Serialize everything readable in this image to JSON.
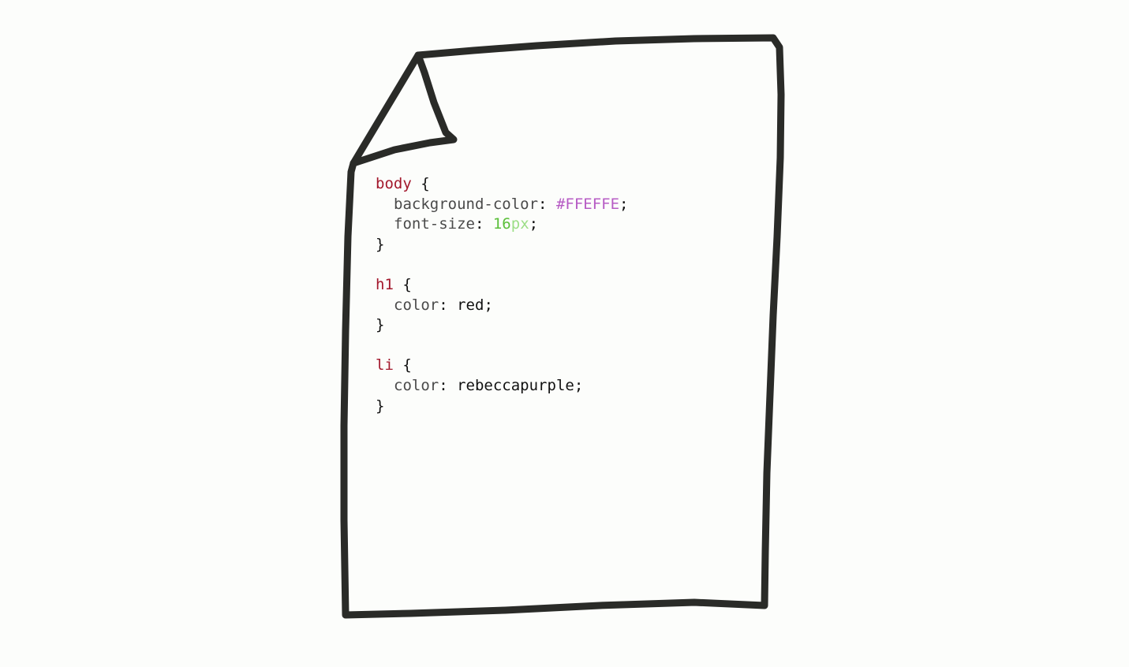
{
  "colors": {
    "background": "#FCFDFB",
    "page_fill": "#FCFDFB",
    "outline": "#2A2B28",
    "selector": "#A3182C",
    "property": "#4A4A4A",
    "hex_value": "#B65BC4",
    "number": "#5BBF3A",
    "unit": "#9CDE86"
  },
  "icons": {
    "document": "document-page-icon",
    "dog_ear": "folded-corner-icon"
  },
  "code": {
    "rules": [
      {
        "selector": "body",
        "open": "{",
        "close": "}",
        "declarations": [
          {
            "property": "background-color",
            "colon": ":",
            "hex": "#FFEFFE",
            "semicolon": ";"
          },
          {
            "property": "font-size",
            "colon": ":",
            "number": "16",
            "unit": "px",
            "semicolon": ";"
          }
        ]
      },
      {
        "selector": "h1",
        "open": "{",
        "close": "}",
        "declarations": [
          {
            "property": "color",
            "colon": ":",
            "value": "red",
            "semicolon": ";"
          }
        ]
      },
      {
        "selector": "li",
        "open": "{",
        "close": "}",
        "declarations": [
          {
            "property": "color",
            "colon": ":",
            "value": "rebeccapurple",
            "semicolon": ";"
          }
        ]
      }
    ]
  }
}
